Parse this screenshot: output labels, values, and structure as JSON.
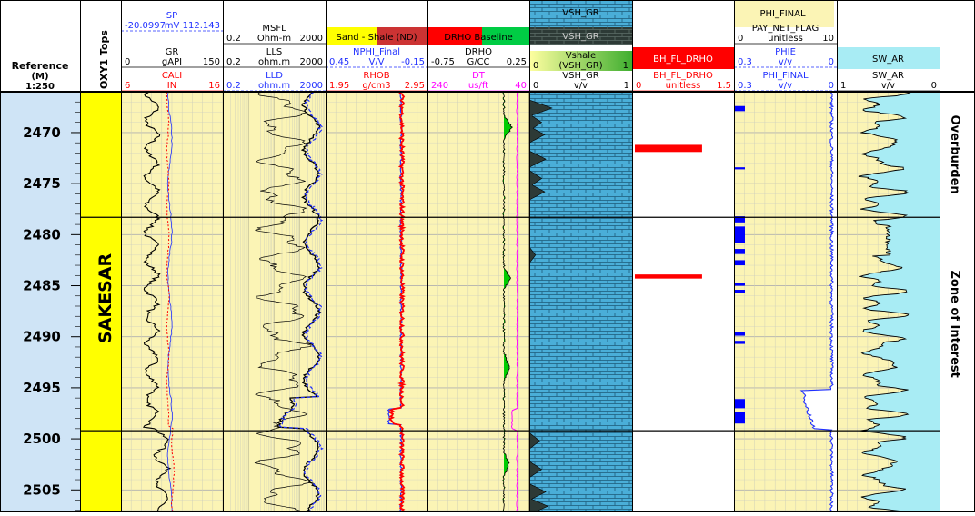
{
  "depth_column": {
    "title": "Reference",
    "unit": "(M)",
    "scale": "1:250"
  },
  "tops_column": {
    "title": "OXY1 Tops",
    "formation": "SAKESAR"
  },
  "zones": [
    {
      "label": "Overburden",
      "top": 2466.0,
      "bottom": 2478.3
    },
    {
      "label": "Zone of Interest",
      "top": 2478.3,
      "bottom": 2499.2
    },
    {
      "label": "",
      "top": 2499.2,
      "bottom": 2507.2
    }
  ],
  "colors": {
    "track_bg": "#fbf4b5",
    "header_yellow": "#fbf4b5",
    "tops_yellow": "#ffff00",
    "depth_bg": "#cfe4f6",
    "grid": "#c8c8c8",
    "black": "#000000",
    "red": "#ff0000",
    "blue": "#2030ff",
    "magenta": "#ff00ff",
    "green": "#00cc00",
    "vsh_fill": "#333333",
    "brick": "#4aaed8",
    "sw_fill": "#a8ecf4",
    "pay_flag": "#0000ff"
  },
  "headers": {
    "track1": [
      {
        "name": "SP",
        "unit": "mV",
        "min": "-20.0997",
        "max": "112.143",
        "color": "#2030ff"
      },
      {
        "name": "GR",
        "unit": "gAPI",
        "min": "0",
        "max": "150",
        "color": "#000000"
      },
      {
        "name": "CALI",
        "unit": "IN",
        "min": "6",
        "max": "16",
        "color": "#ff0000"
      }
    ],
    "track2": [
      {
        "name": "MSFL",
        "unit": "Ohm-m",
        "min": "0.2",
        "max": "2000",
        "color": "#000000"
      },
      {
        "name": "LLS",
        "unit": "ohm.m",
        "min": "0.2",
        "max": "2000",
        "color": "#000000"
      },
      {
        "name": "LLD",
        "unit": "ohm.m",
        "min": "0.2",
        "max": "2000",
        "color": "#2030ff"
      }
    ],
    "track3": {
      "fill_label": "Sand - Shale (ND)",
      "curves": [
        {
          "name": "NPHI_Final",
          "unit": "V/V",
          "min": "0.45",
          "max": "-0.15",
          "color": "#2030ff"
        },
        {
          "name": "RHOB",
          "unit": "g/cm3",
          "min": "1.95",
          "max": "2.95",
          "color": "#ff0000"
        }
      ]
    },
    "track4": {
      "fill_label": "DRHO Baseline",
      "curves": [
        {
          "name": "DRHO",
          "unit": "G/CC",
          "min": "-0.75",
          "max": "0.25",
          "color": "#000000"
        },
        {
          "name": "DT",
          "unit": "us/ft",
          "min": "240",
          "max": "40",
          "color": "#ff00ff"
        }
      ]
    },
    "track5": {
      "fill_top": "VSH_GR",
      "fill_bottom": "VSH_GR",
      "vshale_label": "Vshale",
      "vshale_range": [
        "0",
        "(VSH_GR)",
        "1"
      ],
      "curve": {
        "name": "VSH_GR",
        "unit": "v/v",
        "min": "0",
        "max": "1",
        "color": "#000000"
      }
    },
    "track6": {
      "fill_label": "BH_FL_DRHO",
      "curve": {
        "name": "BH_FL_DRHO",
        "unit": "unitless",
        "min": "0",
        "max": "1.5",
        "color": "#ff0000"
      }
    },
    "track7": {
      "fill_label": "PHI_FINAL",
      "curves": [
        {
          "name": "PAY_NET_FLAG",
          "unit": "unitless",
          "min": "0",
          "max": "10",
          "color": "#000000"
        },
        {
          "name": "PHIE",
          "unit": "v/v",
          "min": "0.3",
          "max": "0",
          "color": "#2030ff"
        },
        {
          "name": "PHI_FINAL",
          "unit": "v/v",
          "min": "0.3",
          "max": "0",
          "color": "#2030ff"
        }
      ]
    },
    "track8": {
      "fill_label": "SW_AR",
      "curve": {
        "name": "SW_AR",
        "unit": "v/v",
        "min": "1",
        "max": "0",
        "color": "#000000"
      }
    }
  },
  "chart_data": {
    "type": "line",
    "depth_range": [
      2466.0,
      2507.2
    ],
    "depth_ticks": [
      2470,
      2475,
      2480,
      2485,
      2490,
      2495,
      2500,
      2505
    ],
    "flags": {
      "BH_FL_DRHO": [
        {
          "top": 2471.2,
          "bottom": 2471.9
        },
        {
          "top": 2483.9,
          "bottom": 2484.3
        }
      ],
      "PAY_NET_FLAG": [
        {
          "top": 2467.4,
          "bottom": 2467.9
        },
        {
          "top": 2473.4,
          "bottom": 2473.6
        },
        {
          "top": 2478.2,
          "bottom": 2478.8
        },
        {
          "top": 2479.2,
          "bottom": 2480.8
        },
        {
          "top": 2481.4,
          "bottom": 2481.9
        },
        {
          "top": 2482.5,
          "bottom": 2483.0
        },
        {
          "top": 2484.7,
          "bottom": 2485.0
        },
        {
          "top": 2485.4,
          "bottom": 2485.7
        },
        {
          "top": 2489.5,
          "bottom": 2489.9
        },
        {
          "top": 2490.4,
          "bottom": 2490.7
        },
        {
          "top": 2496.1,
          "bottom": 2497.0
        },
        {
          "top": 2497.4,
          "bottom": 2498.5
        }
      ]
    },
    "vsh_peaks": [
      {
        "depth": 2467.6,
        "value": 0.22
      },
      {
        "depth": 2469.0,
        "value": 0.12
      },
      {
        "depth": 2470.2,
        "value": 0.15
      },
      {
        "depth": 2472.6,
        "value": 0.16
      },
      {
        "depth": 2474.5,
        "value": 0.12
      },
      {
        "depth": 2475.8,
        "value": 0.15
      },
      {
        "depth": 2482.0,
        "value": 0.06
      },
      {
        "depth": 2500.2,
        "value": 0.1
      },
      {
        "depth": 2503.0,
        "value": 0.12
      },
      {
        "depth": 2505.2,
        "value": 0.16
      },
      {
        "depth": 2506.6,
        "value": 0.18
      }
    ]
  }
}
